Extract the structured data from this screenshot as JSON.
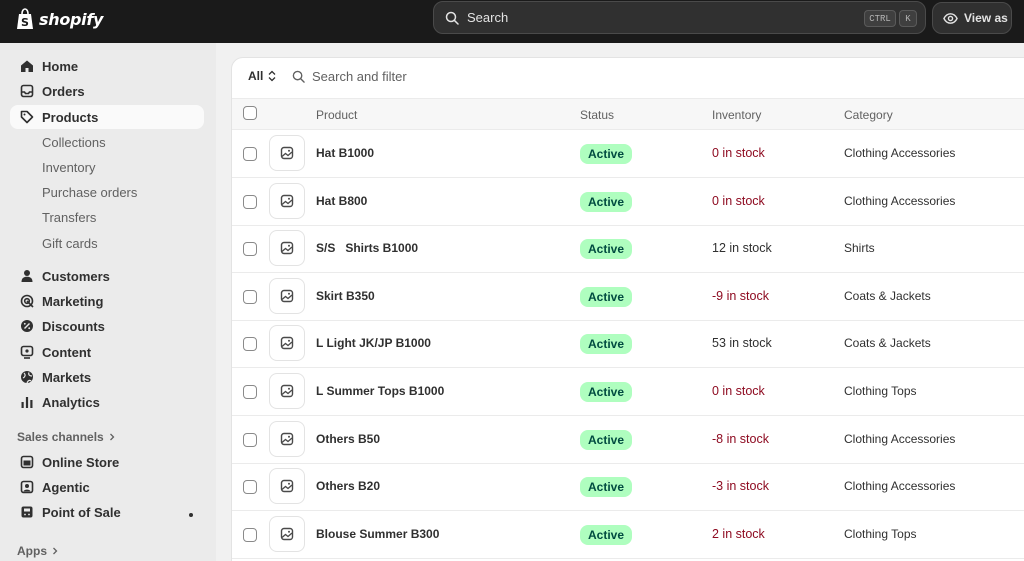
{
  "topbar": {
    "logo_text": "shopify",
    "search_placeholder": "Search",
    "shortcut_ctrl": "CTRL",
    "shortcut_k": "K",
    "view_as_label": "View as"
  },
  "sidebar": {
    "main": [
      {
        "label": "Home",
        "icon": "home-icon"
      },
      {
        "label": "Orders",
        "icon": "inbox-icon"
      },
      {
        "label": "Products",
        "icon": "tag-icon",
        "active": true
      }
    ],
    "product_subs": [
      "Collections",
      "Inventory",
      "Purchase orders",
      "Transfers",
      "Gift cards"
    ],
    "more": [
      {
        "label": "Customers",
        "icon": "person-icon"
      },
      {
        "label": "Marketing",
        "icon": "target-icon"
      },
      {
        "label": "Discounts",
        "icon": "discount-icon"
      },
      {
        "label": "Content",
        "icon": "content-icon"
      },
      {
        "label": "Markets",
        "icon": "globe-icon"
      },
      {
        "label": "Analytics",
        "icon": "chart-icon"
      }
    ],
    "sales_channels_label": "Sales channels",
    "channels": [
      {
        "label": "Online Store",
        "icon": "store-icon"
      },
      {
        "label": "Agentic",
        "icon": "agent-icon"
      },
      {
        "label": "Point of Sale",
        "icon": "pos-icon"
      }
    ],
    "apps_label": "Apps"
  },
  "main": {
    "filter_tab": "All",
    "search_placeholder": "Search and filter",
    "columns": [
      "Product",
      "Status",
      "Inventory",
      "Category"
    ],
    "rows": [
      {
        "product": "Hat B1000",
        "status": "Active",
        "inventory": "0 in stock",
        "low": true,
        "category": "Clothing Accessories"
      },
      {
        "product": "Hat B800",
        "status": "Active",
        "inventory": "0 in stock",
        "low": true,
        "category": "Clothing Accessories"
      },
      {
        "product": "S/S   Shirts B1000",
        "status": "Active",
        "inventory": "12 in stock",
        "low": false,
        "category": "Shirts"
      },
      {
        "product": "Skirt B350",
        "status": "Active",
        "inventory": "-9 in stock",
        "low": true,
        "category": "Coats & Jackets"
      },
      {
        "product": "L Light JK/JP B1000",
        "status": "Active",
        "inventory": "53 in stock",
        "low": false,
        "category": "Coats & Jackets"
      },
      {
        "product": "L Summer Tops B1000",
        "status": "Active",
        "inventory": "0 in stock",
        "low": true,
        "category": "Clothing Tops"
      },
      {
        "product": "Others B50",
        "status": "Active",
        "inventory": "-8 in stock",
        "low": true,
        "category": "Clothing Accessories"
      },
      {
        "product": "Others B20",
        "status": "Active",
        "inventory": "-3 in stock",
        "low": true,
        "category": "Clothing Accessories"
      },
      {
        "product": "Blouse Summer B300",
        "status": "Active",
        "inventory": "2 in stock",
        "low": true,
        "category": "Clothing Tops"
      }
    ]
  },
  "colors": {
    "topbar": "#1a1a1a",
    "sidebar": "#ebebeb",
    "active_badge_bg": "#affebf",
    "active_badge_text": "#014b40",
    "low_stock": "#8e0b21"
  }
}
